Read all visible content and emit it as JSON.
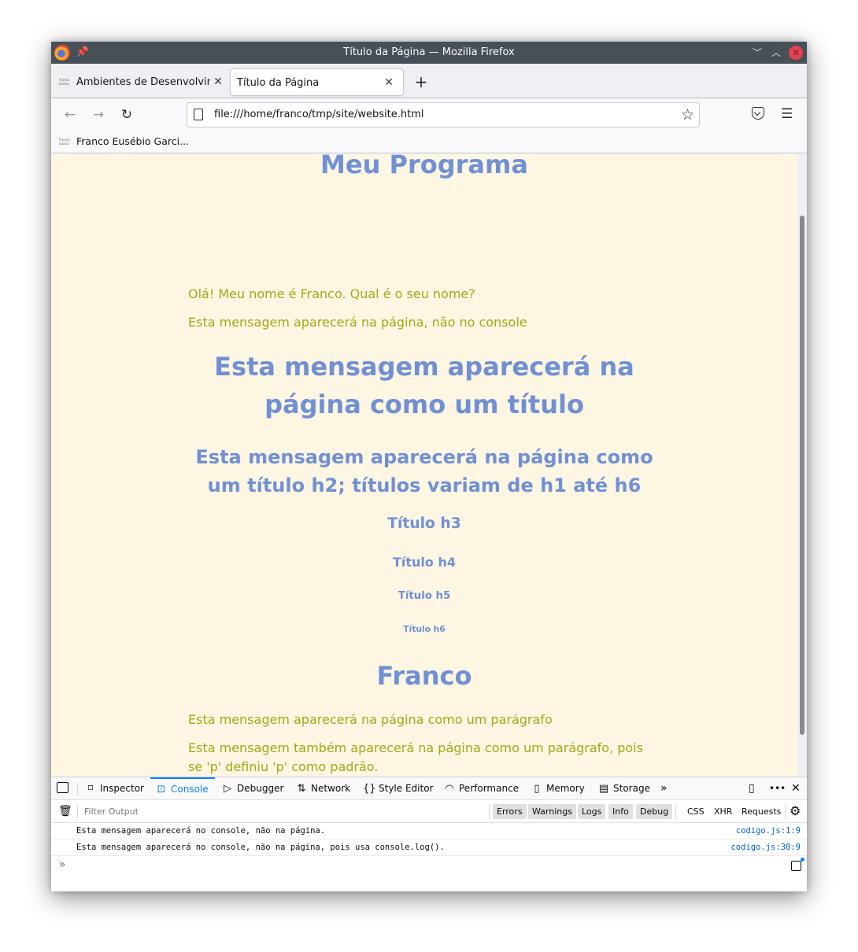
{
  "window": {
    "title": "Título da Página — Mozilla Firefox"
  },
  "tabs": [
    {
      "label": "Ambientes de Desenvolvimento",
      "favicon": "Franco Garcia",
      "active": false
    },
    {
      "label": "Título da Página",
      "active": true
    }
  ],
  "navbar": {
    "url": "file:///home/franco/tmp/site/website.html"
  },
  "bookmarks": [
    {
      "label": "Franco Eusébio Garci...",
      "favicon": "Franco Garcia"
    }
  ],
  "page": {
    "title_top": "Meu Programa",
    "p1": "Olá! Meu nome é Franco. Qual é o seu nome?",
    "p2": "Esta mensagem aparecerá na página, não no console",
    "h1": "Esta mensagem aparecerá na página como um título",
    "h2": "Esta mensagem aparecerá na página como um título h2; títulos variam de h1 até h6",
    "h3": "Título h3",
    "h4": "Título h4",
    "h5": "Título h5",
    "h6": "Título h6",
    "name_heading": "Franco",
    "p3": "Esta mensagem aparecerá na página como um parágrafo",
    "p4": "Esta mensagem também aparecerá na página como um parágrafo, pois se 'p' definiu 'p' como padrão."
  },
  "devtools": {
    "tabs": [
      {
        "label": "Inspector",
        "icon": "inspector-icon"
      },
      {
        "label": "Console",
        "icon": "console-icon",
        "active": true
      },
      {
        "label": "Debugger",
        "icon": "debugger-icon"
      },
      {
        "label": "Network",
        "icon": "network-icon"
      },
      {
        "label": "Style Editor",
        "icon": "style-editor-icon"
      },
      {
        "label": "Performance",
        "icon": "performance-icon"
      },
      {
        "label": "Memory",
        "icon": "memory-icon"
      },
      {
        "label": "Storage",
        "icon": "storage-icon"
      }
    ],
    "filter_placeholder": "Filter Output",
    "levels": [
      "Errors",
      "Warnings",
      "Logs",
      "Info",
      "Debug"
    ],
    "extra_filters": [
      "CSS",
      "XHR",
      "Requests"
    ],
    "logs": [
      {
        "message": "Esta mensagem aparecerá no console, não na página.",
        "source": "codigo.js:1:9"
      },
      {
        "message": "Esta mensagem aparecerá no console, não na página, pois usa console.log().",
        "source": "codigo.js:30:9"
      }
    ],
    "prompt": "»"
  },
  "colors": {
    "heading": "#7190d4",
    "paragraph": "#a3a815",
    "page_background": "#fcf6e3",
    "accent": "#0a84ff"
  }
}
